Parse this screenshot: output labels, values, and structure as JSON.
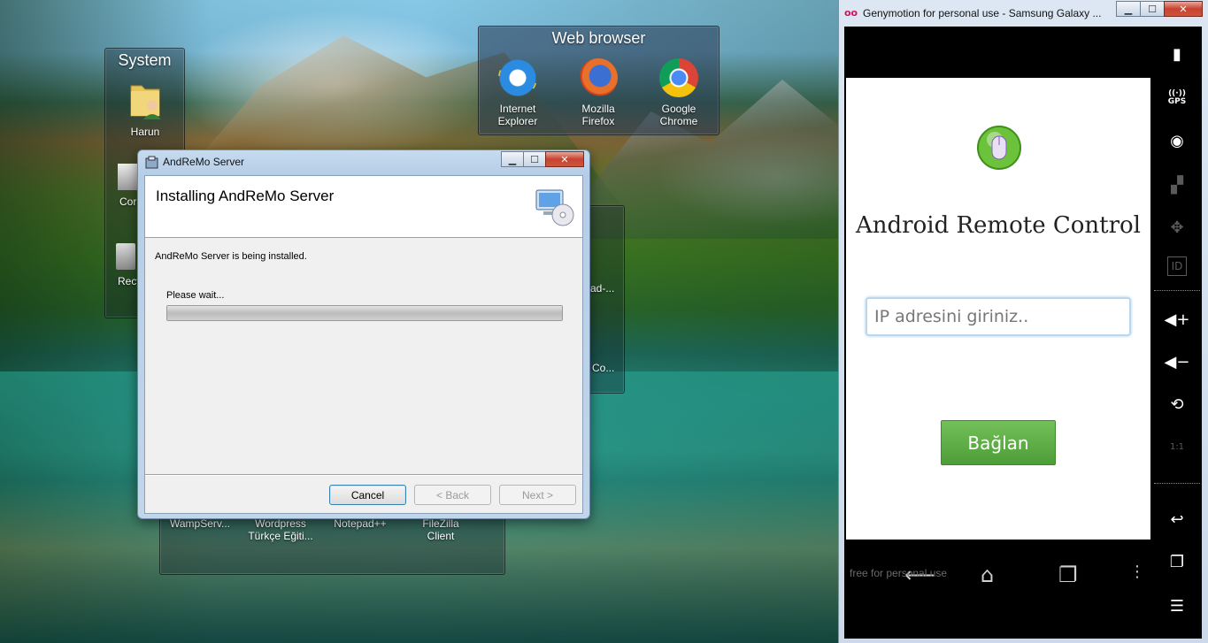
{
  "desktop": {
    "system_fence": {
      "title": "System",
      "items": [
        "Harun",
        "Cor",
        "Recy"
      ]
    },
    "web_fence": {
      "title": "Web browser",
      "items": [
        {
          "label_line1": "Internet",
          "label_line2": "Explorer",
          "icon": "internet-explorer-icon"
        },
        {
          "label_line1": "Mozilla",
          "label_line2": "Firefox",
          "icon": "firefox-icon"
        },
        {
          "label_line1": "Google",
          "label_line2": "Chrome",
          "icon": "chrome-icon"
        }
      ]
    },
    "partial_fence": {
      "items": [
        "ad-...",
        "Co..."
      ]
    },
    "bottom_fence": {
      "items": [
        {
          "line1": "WampServ...",
          "line2": ""
        },
        {
          "line1": "Wordpress",
          "line2": "Türkçe Eğiti..."
        },
        {
          "line1": "Notepad++",
          "line2": ""
        },
        {
          "line1": "FileZilla",
          "line2": "Client"
        }
      ]
    }
  },
  "installer": {
    "title": "AndReMo Server",
    "heading": "Installing AndReMo Server",
    "status": "AndReMo Server is being installed.",
    "wait": "Please wait...",
    "progress": 1.0,
    "buttons": {
      "cancel": "Cancel",
      "back": "< Back",
      "next": "Next >"
    }
  },
  "genymotion": {
    "title": "Genymotion for personal use - Samsung Galaxy ...",
    "app": {
      "title": "Android Remote Control",
      "ip_placeholder": "IP adresini giriniz..",
      "connect": "Bağlan"
    },
    "watermark": "free for personal use",
    "sidebar": {
      "gps": "GPS",
      "id": "ID",
      "scale": "1:1"
    }
  },
  "colors": {
    "connect_green": "#5cab44",
    "close_red": "#c7432f"
  }
}
